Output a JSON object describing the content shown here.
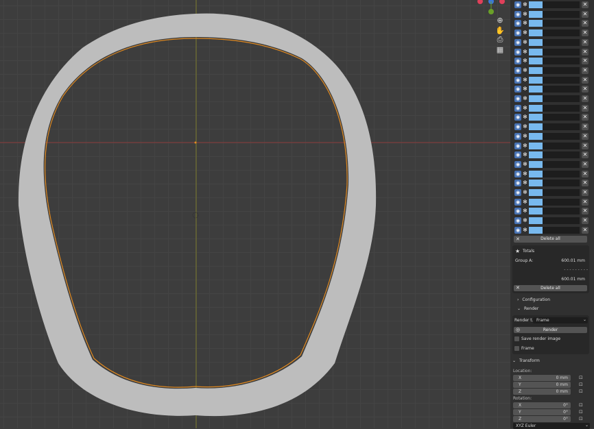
{
  "viewport": {
    "gizmo_axes": [
      "X",
      "Y",
      "Z"
    ],
    "nav_icons": [
      "zoom-icon",
      "hand-icon",
      "camera-icon",
      "grid-icon"
    ]
  },
  "measure_list": {
    "row_count": 25,
    "delete_all_label": "Delete all",
    "row_swatch_color": "#78b9ee"
  },
  "totals": {
    "title": "Totals",
    "group_label": "Group A:",
    "group_value": "600.01 mm",
    "separator": "- - - - - - - - -",
    "sum_value": "600.01 mm",
    "delete_all_label": "Delete all"
  },
  "configuration": {
    "label": "Configuration"
  },
  "render": {
    "label": "Render",
    "render_type_label": "Render t...",
    "render_type_value": "Frame",
    "render_button": "Render",
    "save_render_label": "Save render image",
    "frame_label": "Frame"
  },
  "transform": {
    "label": "Transform",
    "location_label": "Location:",
    "location": [
      {
        "axis": "X",
        "value": "0 mm"
      },
      {
        "axis": "Y",
        "value": "0 mm"
      },
      {
        "axis": "Z",
        "value": "0 mm"
      }
    ],
    "rotation_label": "Rotation:",
    "rotation": [
      {
        "axis": "X",
        "value": "0°"
      },
      {
        "axis": "Y",
        "value": "0°"
      },
      {
        "axis": "Z",
        "value": "0°"
      }
    ],
    "rotation_mode": "XYZ Euler"
  }
}
